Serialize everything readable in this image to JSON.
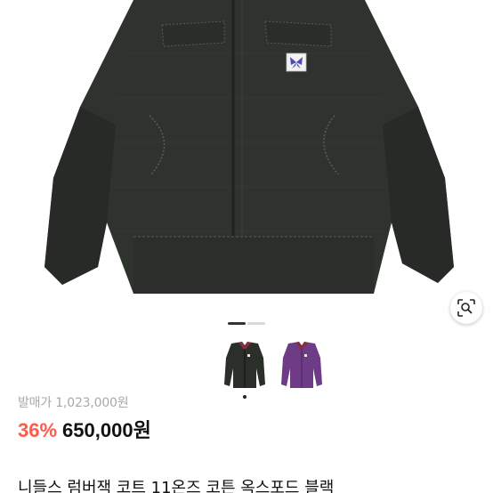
{
  "product": {
    "original_price_label": "발매가 1,023,000원",
    "discount_rate": "36%",
    "sale_price": "650,000원",
    "title": "니들스 럼버잭 코트 11온즈 코튼 옥스포드 블랙"
  },
  "gallery": {
    "active_index": 0,
    "total": 2
  },
  "thumbnails": [
    {
      "variant": "black"
    },
    {
      "variant": "purple"
    }
  ],
  "icons": {
    "lens": "lens-search-icon",
    "butterfly": "butterfly-logo-icon"
  },
  "colors": {
    "discount": "#ff5a4a",
    "jacket_black": "#2b2f2a",
    "jacket_purple": "#6e3c86"
  }
}
